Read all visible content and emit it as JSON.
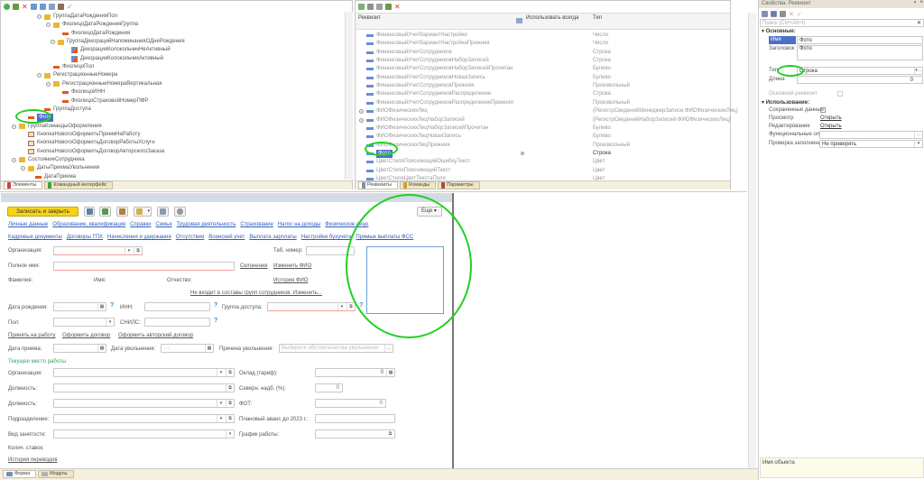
{
  "tree": {
    "rows": [
      {
        "label": "ГруппаДатаРожденияПол",
        "icon": "folder",
        "x": 50
      },
      {
        "label": "ФизлицоДатаРожденияГруппа",
        "icon": "folder",
        "x": 60
      },
      {
        "label": "ФизлицоДатаРождения",
        "icon": "field",
        "x": 70
      },
      {
        "label": "ГруппаДекорацийНапоминанияОДнеРождения",
        "icon": "folder",
        "x": 65
      },
      {
        "label": "ДекорацияКолокольчикНеАктивный",
        "icon": "decoration",
        "x": 80
      },
      {
        "label": "ДекорацияКолокольчикАктивный",
        "icon": "decoration",
        "x": 80
      },
      {
        "label": "ФизлицоПол",
        "icon": "field",
        "x": 60
      },
      {
        "label": "РегистрационныеНомера",
        "icon": "folder",
        "x": 50
      },
      {
        "label": "РегистрационныеНомераВертикальная",
        "icon": "folder",
        "x": 60
      },
      {
        "label": "ФизлицоИНН",
        "icon": "field",
        "x": 70
      },
      {
        "label": "ФизлицоСтраховойНомерПФР",
        "icon": "field",
        "x": 70
      },
      {
        "label": "ГруппаДоступа",
        "icon": "field",
        "x": 50
      },
      {
        "label": "Фото",
        "icon": "field",
        "x": 32,
        "selected": true
      },
      {
        "label": "ГруппаКомандыОформления",
        "icon": "folder",
        "x": 22
      },
      {
        "label": "КнопкаНовогоОформитьПриемНаРаботу",
        "icon": "button",
        "x": 32
      },
      {
        "label": "КнопкаНовогоОформитьДоговорРаботыУслуги",
        "icon": "button",
        "x": 32
      },
      {
        "label": "КнопкаНовогоОформитьДоговорАвторскогоЗаказа",
        "icon": "button",
        "x": 32
      },
      {
        "label": "СостояниеСотрудника",
        "icon": "folder",
        "x": 22
      },
      {
        "label": "ДатыПриемаУвольнения",
        "icon": "folder",
        "x": 32
      },
      {
        "label": "ДатаПриема",
        "icon": "field",
        "x": 40
      }
    ],
    "tabs": [
      "Элементы",
      "Командный интерфейс"
    ]
  },
  "attributes": {
    "columns": [
      "Реквизит",
      "Использовать всегда",
      "Тип"
    ],
    "rows": [
      {
        "name": "ФинансовыйУчетВариантНастройки",
        "type": "Число"
      },
      {
        "name": "ФинансовыйУчетВариантНастройкиПрежняя",
        "type": "Число"
      },
      {
        "name": "ФинансовыйУчетСотрудников",
        "type": "Строка"
      },
      {
        "name": "ФинансовыйУчетСотрудниковНаборЗаписей",
        "type": "Строка"
      },
      {
        "name": "ФинансовыйУчетСотрудниковНаборЗаписейПрочитан",
        "type": "Булево"
      },
      {
        "name": "ФинансовыйУчетСотрудниковНоваяЗапись",
        "type": "Булево"
      },
      {
        "name": "ФинансовыйУчетСотрудниковПрежняя",
        "type": "Произвольный"
      },
      {
        "name": "ФинансовыйУчетСотрудниковРаспределение",
        "type": "Строка"
      },
      {
        "name": "ФинансовыйУчетСотрудниковРаспределениеПрежняя",
        "type": "Произвольный"
      },
      {
        "name": "ФИОФизическихЛиц",
        "type": "(РегистрСведенийМенеджерЗаписи.ФИОФизическихЛиц)",
        "expand": true
      },
      {
        "name": "ФИОФизическихЛицНаборЗаписей",
        "type": "(РегистрСведенийНаборЗаписей.ФИОФизическихЛиц)",
        "expand": true
      },
      {
        "name": "ФИОФизическихЛицНаборЗаписейПрочитан",
        "type": "Булево"
      },
      {
        "name": "ФИОФизическихЛицНоваяЗапись",
        "type": "Булево"
      },
      {
        "name": "ФИОФизическихЛицПрежняя",
        "type": "Произвольный"
      },
      {
        "name": "Фото",
        "type": "Строка",
        "selected": true
      },
      {
        "name": "ЦветСтиляПоясняющийОшибкуТекст",
        "type": "Цвет"
      },
      {
        "name": "ЦветСтиляПоясняющийТекст",
        "type": "Цвет"
      },
      {
        "name": "ЦветСтиляЦветТекстаПоля",
        "type": "Цвет"
      }
    ],
    "tabs": [
      "Реквизиты",
      "Команды",
      "Параметры"
    ]
  },
  "props": {
    "title": "Свойства: Реквизит",
    "search_placeholder": "Поиск (Ctrl+Alt+I)",
    "sec_main": "Основные:",
    "name_label": "Имя",
    "name_value": "Фото",
    "caption_label": "Заголовок",
    "caption_value": "Фото",
    "type_label": "Тип",
    "type_value": "Строка",
    "length_label": "Длина",
    "length_value": "0",
    "main_attr": "Основной реквизит",
    "sec_use": "Использование:",
    "saved_label": "Сохраненные данные",
    "view_label": "Просмотр",
    "view_link": "Открыть",
    "edit_label": "Редактирование",
    "edit_link": "Открыть",
    "func_label": "Функциональные опции",
    "check_label": "Проверка заполнения",
    "check_value": "Не проверять",
    "object_name": "Имя объекта"
  },
  "form": {
    "save_close": "Записать и закрыть",
    "more": "Еще",
    "links1": [
      "Личные данные",
      "Образование, квалификация",
      "Справки",
      "Семья",
      "Трудовая деятельность",
      "Страхование",
      "Налог на доходы",
      "Физическое лицо"
    ],
    "links2": [
      "Кадровые документы",
      "Договоры ГПХ",
      "Начисления и удержания",
      "Отсутствия",
      "Воинский учет",
      "Выплата зарплаты",
      "Настройки бухучета",
      "Прямые выплаты ФСС"
    ],
    "org": "Организация:",
    "tab_no": "Таб. номер:",
    "full_name": "Полное имя:",
    "declensions": "Склонения",
    "change_fio": "Изменить ФИО",
    "surname": "Фамилия:",
    "first_name": "Имя:",
    "patronymic": "Отчество:",
    "fio_history": "История ФИО",
    "groups_link": "Не входит в составы групп сотрудников. Изменить...",
    "birth": "Дата рождения:",
    "date_empty": " .  .",
    "inn": "ИНН:",
    "access_group": "Группа доступа:",
    "gender": "Пол:",
    "snils": "СНИЛС:",
    "hire_link": "Принять на работу",
    "contract_link": "Оформить договор",
    "author_link": "Оформить авторский договор",
    "hire_date": "Дата приема:",
    "dismiss_date": "Дата увольнения:",
    "dismiss_reason": "Причина увольнения:",
    "dismiss_placeholder": "Выберите обстоятельства увольнения",
    "current_job": "Текущее место работы",
    "org2": "Организация:",
    "salary": "Оклад (тариф):",
    "salary_value": "0",
    "position": "Должность:",
    "north": "Северн. надб. (%):",
    "north_value": "0",
    "position2": "Должность:",
    "fot": "ФОТ:",
    "fot_value": "0",
    "division": "Подразделение:",
    "advance": "Плановый аванс до 2023 г.:",
    "employment": "Вид занятости:",
    "schedule": "График работы:",
    "rates": "Колич. ставок:",
    "transfers": "История переводов",
    "tabs": [
      "Форма",
      "Модуль"
    ]
  }
}
